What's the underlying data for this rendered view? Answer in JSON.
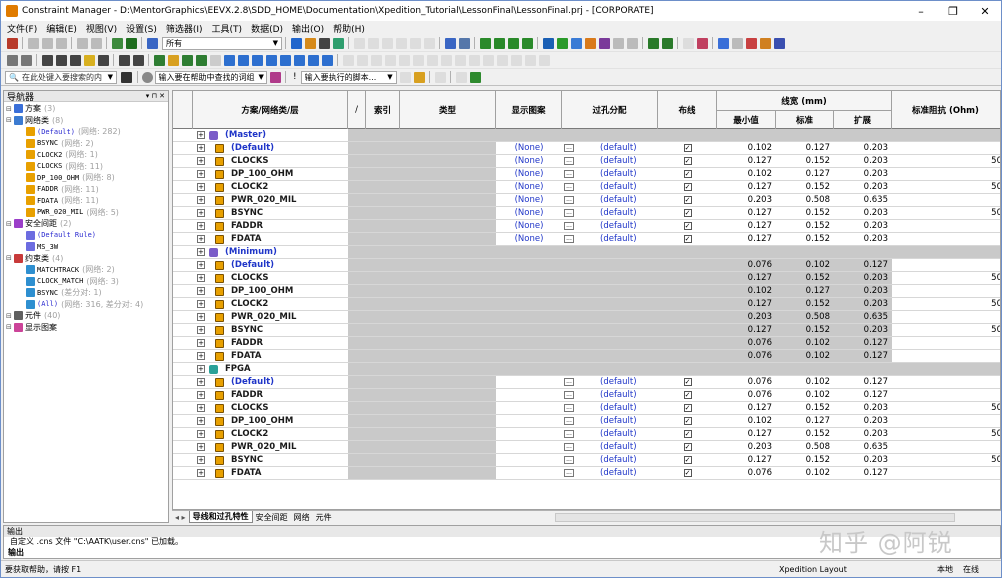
{
  "window": {
    "title": "Constraint Manager - D:\\MentorGraphics\\EEVX.2.8\\SDD_HOME\\Documentation\\Xpedition_Tutorial\\LessonFinal\\LessonFinal.prj - [CORPORATE]",
    "minimize": "–",
    "maximize": "❐",
    "close": "✕"
  },
  "menu": [
    "文件(F)",
    "编辑(E)",
    "视图(V)",
    "设置(S)",
    "筛选器(I)",
    "工具(T)",
    "数据(D)",
    "输出(O)",
    "帮助(H)"
  ],
  "toolbar": {
    "filter_value": "所有",
    "search_placeholder": "在此处键入要搜索的内",
    "help_search": "输入要在帮助中查找的词组",
    "cmd_input": "输入要执行的脚本..."
  },
  "navigator": {
    "title": "导航器",
    "items": [
      {
        "label": "方案",
        "count": "(3)",
        "indent": 0,
        "color": "#3a6fd8"
      },
      {
        "label": "网络类",
        "count": "(8)",
        "indent": 0,
        "color": "#3b7bd1"
      },
      {
        "label": "(Default)",
        "count": "(网络: 282)",
        "indent": 1,
        "mono": true,
        "blue": true,
        "color": "#e8a000"
      },
      {
        "label": "BSYNC",
        "count": "(网络: 2)",
        "indent": 1,
        "mono": true,
        "color": "#e8a000"
      },
      {
        "label": "CLOCK2",
        "count": "(网络: 1)",
        "indent": 1,
        "mono": true,
        "color": "#e8a000"
      },
      {
        "label": "CLOCKS",
        "count": "(网络: 11)",
        "indent": 1,
        "mono": true,
        "color": "#e8a000"
      },
      {
        "label": "DP_100_OHM",
        "count": "(网络: 8)",
        "indent": 1,
        "mono": true,
        "color": "#e8a000"
      },
      {
        "label": "FADDR",
        "count": "(网络: 11)",
        "indent": 1,
        "mono": true,
        "color": "#e8a000"
      },
      {
        "label": "FDATA",
        "count": "(网络: 11)",
        "indent": 1,
        "mono": true,
        "color": "#e8a000"
      },
      {
        "label": "PWR_020_MIL",
        "count": "(网络: 5)",
        "indent": 1,
        "mono": true,
        "color": "#e8a000"
      },
      {
        "label": "安全间距",
        "count": "(2)",
        "indent": 0,
        "color": "#9b3fc9"
      },
      {
        "label": "(Default Rule)",
        "count": "",
        "indent": 1,
        "mono": true,
        "blue": true,
        "color": "#6c6ce0"
      },
      {
        "label": "MS_3W",
        "count": "",
        "indent": 1,
        "mono": true,
        "color": "#6c6ce0"
      },
      {
        "label": "约束类",
        "count": "(4)",
        "indent": 0,
        "color": "#c83a3a"
      },
      {
        "label": "MATCHTRACK",
        "count": "(网络: 2)",
        "indent": 1,
        "mono": true,
        "color": "#2e8fd0"
      },
      {
        "label": "CLOCK_MATCH",
        "count": "(网络: 3)",
        "indent": 1,
        "mono": true,
        "color": "#2e8fd0"
      },
      {
        "label": "BSYNC",
        "count": "(差分对: 1)",
        "indent": 1,
        "mono": true,
        "color": "#2e8fd0"
      },
      {
        "label": "(All)",
        "count": "(网络: 316, 差分对: 4)",
        "indent": 1,
        "mono": true,
        "blue": true,
        "color": "#2e8fd0"
      },
      {
        "label": "元件",
        "count": "(40)",
        "indent": 0,
        "color": "#606060"
      },
      {
        "label": "显示图案",
        "count": "",
        "indent": 0,
        "color": "#cc4499"
      }
    ]
  },
  "grid": {
    "headers": {
      "scheme": "方案/网络类/层",
      "slash": "/",
      "index": "索引",
      "type": "类型",
      "display": "显示图案",
      "via": "过孔分配",
      "route": "布线",
      "width": "线宽 (mm)",
      "wmin": "最小值",
      "wstd": "标准",
      "wexp": "扩展",
      "imp": "标准阻抗 (Ohm)"
    },
    "rows": [
      {
        "kind": "scheme",
        "name": "(Master)",
        "icon": "#7a5cc8"
      },
      {
        "kind": "net",
        "name": "(Default)",
        "def": true,
        "disp": "(None)",
        "via": "(default)",
        "route": true,
        "min": "0.102",
        "std": "0.127",
        "exp": "0.203",
        "imp": ""
      },
      {
        "kind": "net",
        "name": "CLOCKS",
        "disp": "(None)",
        "via": "(default)",
        "route": true,
        "min": "0.127",
        "std": "0.152",
        "exp": "0.203",
        "imp": "50"
      },
      {
        "kind": "net",
        "name": "DP_100_OHM",
        "disp": "(None)",
        "via": "(default)",
        "route": true,
        "min": "0.102",
        "std": "0.127",
        "exp": "0.203",
        "imp": ""
      },
      {
        "kind": "net",
        "name": "CLOCK2",
        "disp": "(None)",
        "via": "(default)",
        "route": true,
        "min": "0.127",
        "std": "0.152",
        "exp": "0.203",
        "imp": "50"
      },
      {
        "kind": "net",
        "name": "PWR_020_MIL",
        "disp": "(None)",
        "via": "(default)",
        "route": true,
        "min": "0.203",
        "std": "0.508",
        "exp": "0.635",
        "imp": ""
      },
      {
        "kind": "net",
        "name": "BSYNC",
        "disp": "(None)",
        "via": "(default)",
        "route": true,
        "min": "0.127",
        "std": "0.152",
        "exp": "0.203",
        "imp": "50"
      },
      {
        "kind": "net",
        "name": "FADDR",
        "disp": "(None)",
        "via": "(default)",
        "route": true,
        "min": "0.127",
        "std": "0.152",
        "exp": "0.203",
        "imp": ""
      },
      {
        "kind": "net",
        "name": "FDATA",
        "disp": "(None)",
        "via": "(default)",
        "route": true,
        "min": "0.127",
        "std": "0.152",
        "exp": "0.203",
        "imp": ""
      },
      {
        "kind": "scheme",
        "name": "(Minimum)",
        "icon": "#7a5cc8"
      },
      {
        "kind": "net",
        "name": "(Default)",
        "def": true,
        "gray": true,
        "min": "0.076",
        "std": "0.102",
        "exp": "0.127",
        "imp": ""
      },
      {
        "kind": "net",
        "name": "CLOCKS",
        "gray": true,
        "min": "0.127",
        "std": "0.152",
        "exp": "0.203",
        "imp": "50"
      },
      {
        "kind": "net",
        "name": "DP_100_OHM",
        "gray": true,
        "min": "0.102",
        "std": "0.127",
        "exp": "0.203",
        "imp": ""
      },
      {
        "kind": "net",
        "name": "CLOCK2",
        "gray": true,
        "min": "0.127",
        "std": "0.152",
        "exp": "0.203",
        "imp": "50"
      },
      {
        "kind": "net",
        "name": "PWR_020_MIL",
        "gray": true,
        "min": "0.203",
        "std": "0.508",
        "exp": "0.635",
        "imp": ""
      },
      {
        "kind": "net",
        "name": "BSYNC",
        "gray": true,
        "min": "0.127",
        "std": "0.152",
        "exp": "0.203",
        "imp": "50"
      },
      {
        "kind": "net",
        "name": "FADDR",
        "gray": true,
        "min": "0.076",
        "std": "0.102",
        "exp": "0.127",
        "imp": ""
      },
      {
        "kind": "net",
        "name": "FDATA",
        "gray": true,
        "min": "0.076",
        "std": "0.102",
        "exp": "0.127",
        "imp": ""
      },
      {
        "kind": "scheme",
        "name": "FPGA",
        "plain": true,
        "icon": "#2aa198"
      },
      {
        "kind": "net",
        "name": "(Default)",
        "def": true,
        "via": "(default)",
        "route": true,
        "min": "0.076",
        "std": "0.102",
        "exp": "0.127",
        "imp": ""
      },
      {
        "kind": "net",
        "name": "FADDR",
        "via": "(default)",
        "route": true,
        "min": "0.076",
        "std": "0.102",
        "exp": "0.127",
        "imp": ""
      },
      {
        "kind": "net",
        "name": "CLOCKS",
        "via": "(default)",
        "route": true,
        "min": "0.127",
        "std": "0.152",
        "exp": "0.203",
        "imp": "50"
      },
      {
        "kind": "net",
        "name": "DP_100_OHM",
        "via": "(default)",
        "route": true,
        "min": "0.102",
        "std": "0.127",
        "exp": "0.203",
        "imp": ""
      },
      {
        "kind": "net",
        "name": "CLOCK2",
        "via": "(default)",
        "route": true,
        "min": "0.127",
        "std": "0.152",
        "exp": "0.203",
        "imp": "50"
      },
      {
        "kind": "net",
        "name": "PWR_020_MIL",
        "via": "(default)",
        "route": true,
        "min": "0.203",
        "std": "0.508",
        "exp": "0.635",
        "imp": ""
      },
      {
        "kind": "net",
        "name": "BSYNC",
        "via": "(default)",
        "route": true,
        "min": "0.127",
        "std": "0.152",
        "exp": "0.203",
        "imp": "50"
      },
      {
        "kind": "net",
        "name": "FDATA",
        "via": "(default)",
        "route": true,
        "min": "0.076",
        "std": "0.102",
        "exp": "0.127",
        "imp": ""
      }
    ]
  },
  "tabs": [
    "导线和过孔特性",
    "安全间距",
    "网络",
    "元件"
  ],
  "output": {
    "title": "输出",
    "line": "自定义 .cns 文件 \"C:\\AATK\\user.cns\" 已加载。",
    "tab": "输出"
  },
  "status": {
    "help": "要获取帮助，请按 F1",
    "app": "Xpedition Layout",
    "local": "本地",
    "online": "在线"
  },
  "watermark": "知乎 @阿锐"
}
